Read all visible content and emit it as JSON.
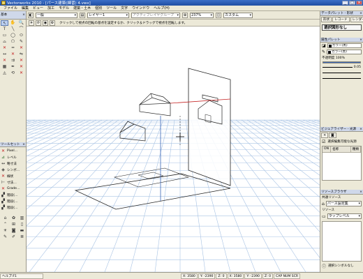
{
  "window": {
    "title": "Vectorworks 2010 - [パース建築(練習) 4.vwx]",
    "minimize": "_",
    "maximize": "□",
    "close": "×"
  },
  "menu": [
    "ファイル",
    "編集",
    "ビュー",
    "加工",
    "モデル",
    "建築・土木",
    "個別",
    "ツール",
    "文字",
    "ウインドウ",
    "ヘルプ(H)"
  ],
  "view_bar": {
    "class_value": "一般",
    "layer_value": "レイヤー1",
    "render_value": "アクティブレイヤグループ",
    "zoom_value": "237%",
    "view_value": "カスタム"
  },
  "mode_bar": {
    "hint": "クリックして視点の回転の基点を設定するか、クリック＆ドラッグで視点を回転します。"
  },
  "tool_palette": {
    "title": "基本",
    "tools": [
      "↖",
      "✋",
      "🔍",
      "T",
      "╲",
      "⌒",
      "▭",
      "◯",
      "⬭",
      "⌓",
      "⬠",
      "✎"
    ]
  },
  "tool_sets": {
    "title": "ツールセット",
    "items": [
      "Pixel…",
      "レベル",
      "略寸法",
      "シンボ…",
      "線状",
      "寸法…",
      "Grade…",
      "階段(…",
      "階段(…",
      "階段(…"
    ]
  },
  "right_palette": {
    "title": "データパレット - 形状",
    "tabs": [
      "形状",
      "レコード",
      "レンダー"
    ],
    "selection_label": "選択図形なし",
    "attr_title": "属性パレット",
    "fill_value": "カラー(黒)",
    "pen_value": "カラー(黒)",
    "opacity_label": "不透明度 100%",
    "opacity_pct": 100,
    "line_weight": "0.05"
  },
  "visualization": {
    "title": "ビジュアライザー - 光源",
    "checkbox_label": "選択編集可能な光源",
    "columns": [
      "ON",
      "名称",
      "種類"
    ]
  },
  "resource_browser": {
    "title": "リソースブラウザ",
    "file_label": "共通リソース",
    "file_value": "パース設定集",
    "resources_label": "リソース",
    "resource_value": "ラップレベル",
    "footer_label": "選択シンボルなし"
  },
  "status_bar": {
    "help": "ヘルプ:F1",
    "x": "X: 3580",
    "y": "Y: -2390",
    "z": "Z: 0",
    "x2": "X: 3580",
    "y2": "Y: -2390",
    "z2": "Z: 0",
    "caps": "CAP NUM SCR"
  },
  "colors": {
    "grid": "#a8c3e4",
    "accent": "#3a66b8",
    "red": "#c42020"
  }
}
